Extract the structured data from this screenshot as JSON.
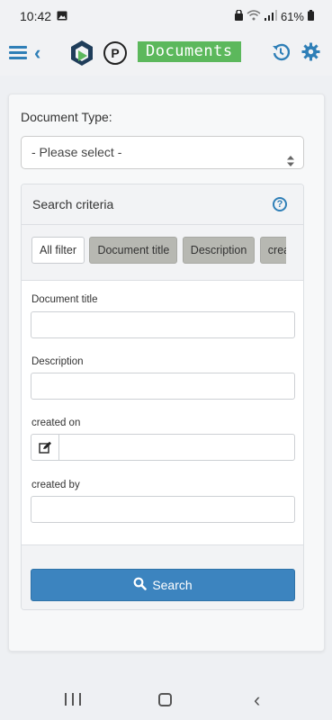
{
  "status_bar": {
    "time": "10:42",
    "battery": "61%"
  },
  "app_bar": {
    "title": "Documents",
    "p_logo_letter": "P",
    "icons": [
      "menu-icon",
      "back-icon",
      "app-logo-icon",
      "p-logo-icon",
      "history-icon",
      "gear-icon"
    ]
  },
  "form": {
    "document_type_label": "Document Type:",
    "document_type_value": "- Please select -"
  },
  "criteria": {
    "title": "Search criteria",
    "help_symbol": "?",
    "chips": [
      "All filter",
      "Document title",
      "Description",
      "crea"
    ],
    "fields": {
      "document_title_label": "Document title",
      "description_label": "Description",
      "created_on_label": "created on",
      "created_by_label": "created by"
    },
    "search_label": "Search"
  },
  "colors": {
    "accent": "#2f7fb7",
    "title_badge": "#5cb85c",
    "search_button": "#3c84bf"
  }
}
